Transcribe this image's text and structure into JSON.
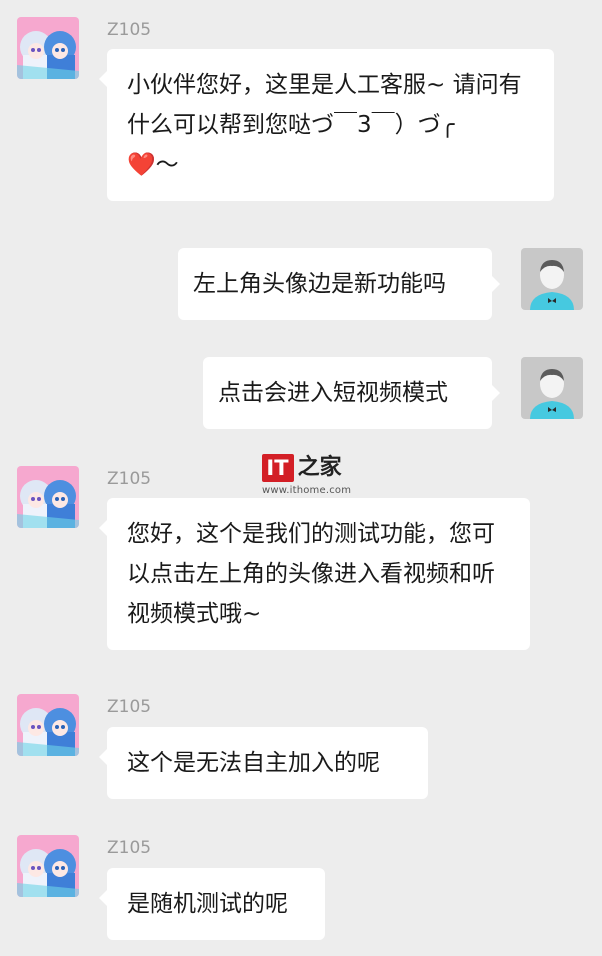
{
  "messages": [
    {
      "sender": "Z105",
      "text": "小伙伴您好，这里是人工客服~ 请问有什么可以帮到您哒づ￣3￣）づ╭",
      "heart": "❤️",
      "tail": "～"
    },
    {
      "text": "左上角头像边是新功能吗"
    },
    {
      "text": "点击会进入短视频模式"
    },
    {
      "sender": "Z105",
      "text": "您好，这个是我们的测试功能，您可以点击左上角的头像进入看视频和听视频模式哦~"
    },
    {
      "sender": "Z105",
      "text": "这个是无法自主加入的呢"
    },
    {
      "sender": "Z105",
      "text": "是随机测试的呢"
    }
  ],
  "watermark": {
    "logo": "IT",
    "logo_cn": "之家",
    "url": "www.ithome.com"
  },
  "colors": {
    "background": "#ededed",
    "bubble": "#ffffff",
    "accent": "#d31f26"
  }
}
